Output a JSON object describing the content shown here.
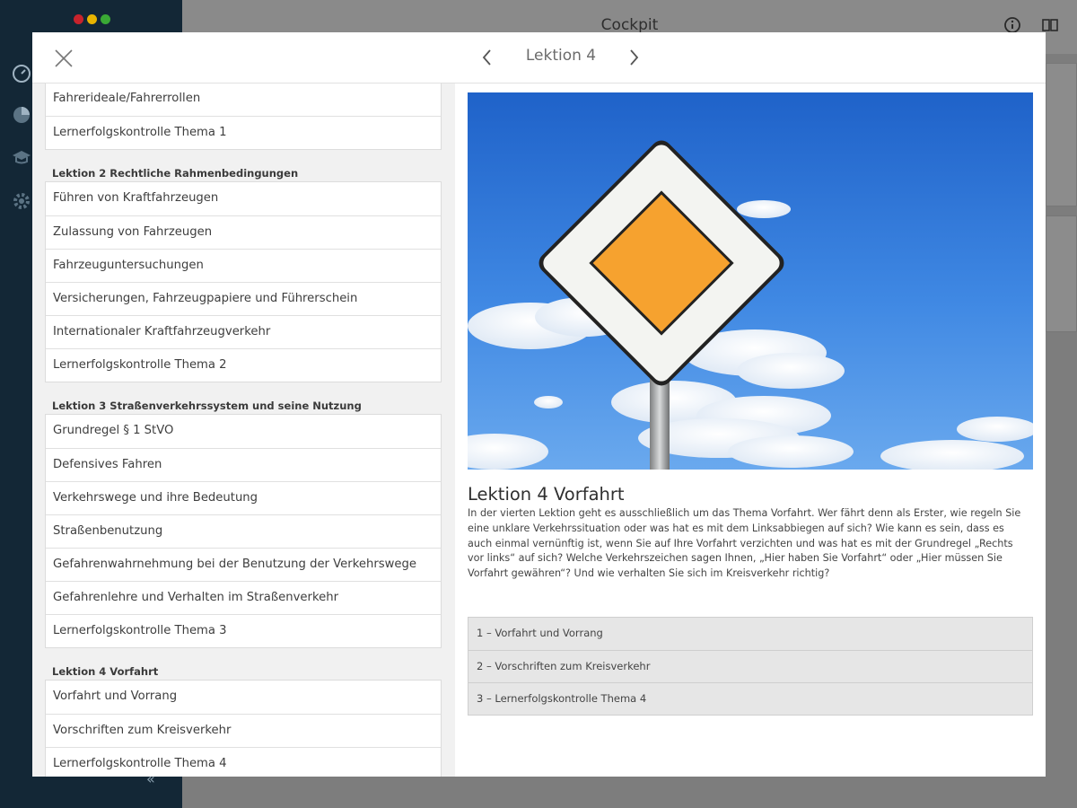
{
  "background_app": {
    "title": "Cockpit",
    "traffic_light_colors": [
      "#c8232c",
      "#e8b400",
      "#3aa935"
    ],
    "sidebar_icons": [
      "dashboard-icon",
      "pie-chart-icon",
      "graduation-cap-icon",
      "gear-icon"
    ],
    "header_icons": [
      "info-icon",
      "book-icon"
    ]
  },
  "modal": {
    "nav_title": "Lektion 4",
    "sections": [
      {
        "title": "",
        "items": [
          "Fahrerideale/Fahrerrollen",
          "Lernerfolgskontrolle Thema 1"
        ]
      },
      {
        "title": "Lektion 2 Rechtliche Rahmenbedingungen",
        "items": [
          "Führen von Kraftfahrzeugen",
          "Zulassung von Fahrzeugen",
          "Fahrzeuguntersuchungen",
          "Versicherungen, Fahrzeugpapiere und Führerschein",
          "Internationaler Kraftfahrzeugverkehr",
          "Lernerfolgskontrolle Thema 2"
        ]
      },
      {
        "title": "Lektion 3 Straßenverkehrssystem und seine Nutzung",
        "items": [
          "Grundregel § 1 StVO",
          "Defensives Fahren",
          "Verkehrswege und ihre Bedeutung",
          "Straßenbenutzung",
          "Gefahrenwahrnehmung bei der Benutzung der Verkehrswege",
          "Gefahrenlehre und Verhalten im Straßenverkehr",
          "Lernerfolgskontrolle Thema 3"
        ]
      },
      {
        "title": "Lektion 4 Vorfahrt",
        "items": [
          "Vorfahrt und Vorrang",
          "Vorschriften zum Kreisverkehr",
          "Lernerfolgskontrolle Thema 4"
        ]
      }
    ],
    "lesson": {
      "title": "Lektion 4 Vorfahrt",
      "description": "In der vierten Lektion geht es ausschließlich um das Thema Vorfahrt. Wer fährt denn als Erster, wie regeln Sie eine unklare Verkehrssituation oder was hat es mit dem Linksabbiegen auf sich? Wie kann es sein, dass es auch einmal vernünftig ist, wenn Sie auf Ihre Vorfahrt verzichten und was hat es mit der Grundregel „Rechts vor links“ auf sich? Welche Verkehrszeichen sagen Ihnen, „Hier haben Sie Vorfahrt“ oder „Hier müssen Sie Vorfahrt gewähren“? Und wie verhalten Sie sich im Kreisverkehr richtig?",
      "topics": [
        "1 – Vorfahrt und Vorrang",
        "2 – Vorschriften zum Kreisverkehr",
        "3 – Lernerfolgskontrolle Thema 4"
      ],
      "image_subject": "priority-road-sign-image"
    }
  }
}
